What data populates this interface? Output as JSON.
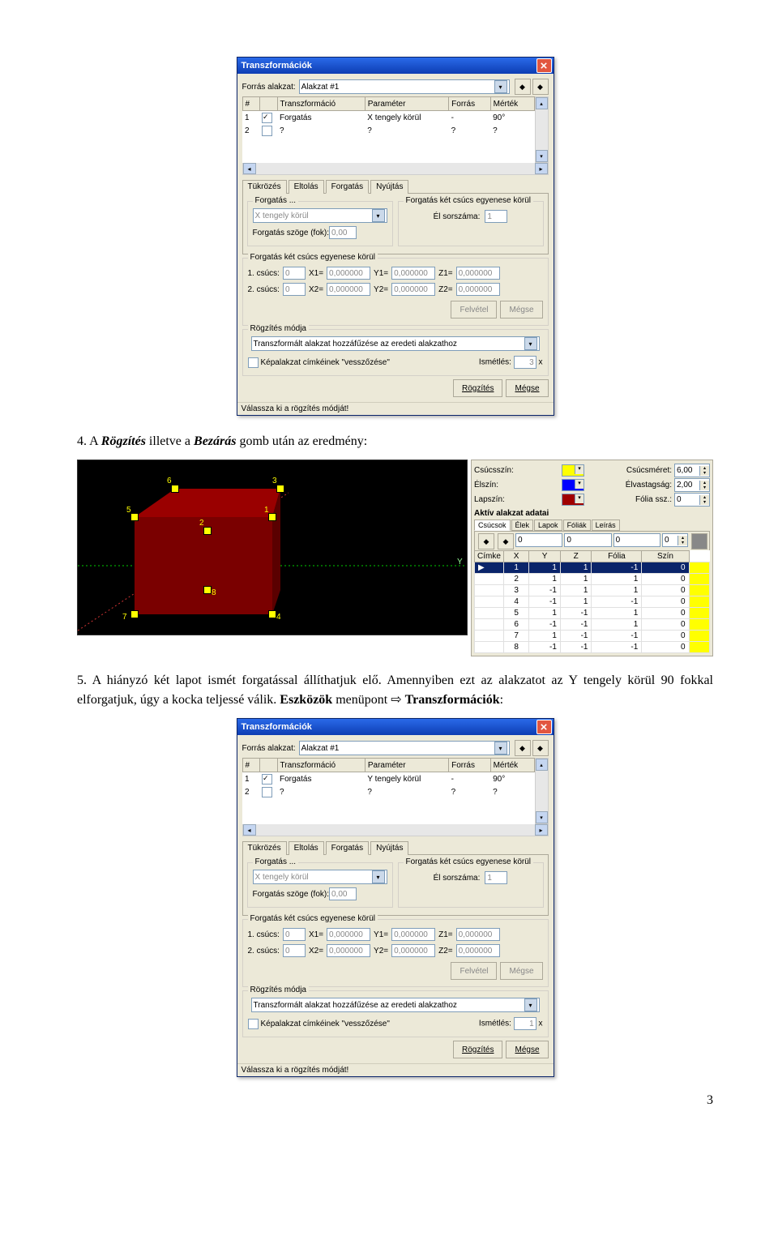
{
  "dialog1": {
    "title": "Transzformációk",
    "source_label": "Forrás alakzat:",
    "source_value": "Alakzat #1",
    "grid_headers": [
      "#",
      "",
      "Transzformáció",
      "Paraméter",
      "Forrás",
      "Mérték"
    ],
    "grid_rows": [
      {
        "n": "1",
        "chk": true,
        "transz": "Forgatás",
        "param": "X tengely körül",
        "forras": "-",
        "mertek": "90°"
      },
      {
        "n": "2",
        "chk": false,
        "transz": "?",
        "param": "?",
        "forras": "?",
        "mertek": "?"
      }
    ],
    "tabs": [
      "Tükrözés",
      "Eltolás",
      "Forgatás",
      "Nyújtás"
    ],
    "active_tab": 2,
    "forgatas_legend": "Forgatás ...",
    "forgatas_axis": "X tengely körül",
    "forgatas_szog_label": "Forgatás szöge (fok):",
    "forgatas_szog_val": "0,00",
    "forgatas_2csucs_legend": "Forgatás két csúcs egyenese körül",
    "el_sorszama": "Él sorszáma:",
    "el_sorszama_val": "1",
    "csucs1": "1. csúcs:",
    "csucs2": "2. csúcs:",
    "zero": "0",
    "coord_zero": "0,000000",
    "X1": "X1=",
    "Y1": "Y1=",
    "Z1": "Z1=",
    "X2": "X2=",
    "Y2": "Y2=",
    "Z2": "Z2=",
    "felvetel": "Felvétel",
    "megse": "Mégse",
    "rogzites_legend": "Rögzítés módja",
    "rogzites_val": "Transzformált alakzat hozzáfűzése az eredeti alakzathoz",
    "kepalakzat": "Képalakzat címkéinek \"vesszőzése\"",
    "ismetles": "Ismétlés:",
    "ismetles_val": "3",
    "x": "x",
    "rogzites_btn": "Rögzítés",
    "megse_btn": "Mégse",
    "status": "Válassza ki a rögzítés módját!"
  },
  "dialog2": {
    "title": "Transzformációk",
    "grid_rows": [
      {
        "n": "1",
        "chk": true,
        "transz": "Forgatás",
        "param": "Y tengely körül",
        "forras": "-",
        "mertek": "90°"
      },
      {
        "n": "2",
        "chk": false,
        "transz": "?",
        "param": "?",
        "forras": "?",
        "mertek": "?"
      }
    ],
    "ismetles_val": "1"
  },
  "para1": {
    "num": "4.",
    "text_a": "A ",
    "rogzites": "Rögzítés",
    "text_b": " illetve a ",
    "bezaras": "Bezárás",
    "text_c": " gomb után az eredmény:"
  },
  "para2": {
    "num": "5.",
    "text_a": "A hiányzó két lapot ismét forgatással állíthatjuk elő. Amennyiben ezt az alakzatot az Y tengely körül 90 fokkal elforgatjuk, úgy a kocka teljessé válik. ",
    "eszkozok": "Eszközök",
    "text_b": " menüpont ",
    "arrow": "⇨ ",
    "transz": "Transzformációk",
    "colon": ":"
  },
  "props": {
    "csucsszin": "Csúcsszín:",
    "csucsmeret": "Csúcsméret:",
    "csucsmeret_val": "6,00",
    "elszin": "Élszín:",
    "elvastagsag": "Élvastagság:",
    "elvastagsag_val": "2,00",
    "lapszin": "Lapszín:",
    "folia_ssz": "Fólia ssz.:",
    "folia_ssz_val": "0",
    "aktiv_title": "Aktív alakzat adatai",
    "mini_tabs": [
      "Csúcsok",
      "Élek",
      "Lapok",
      "Fóliák",
      "Leírás"
    ],
    "spinner_row": [
      "0",
      "0",
      "0",
      "0"
    ],
    "headers": [
      "Címke",
      "X",
      "Y",
      "Z",
      "Fólia",
      "Szín"
    ],
    "rows": [
      {
        "c": "1",
        "x": "1",
        "y": "1",
        "z": "-1",
        "f": "0"
      },
      {
        "c": "2",
        "x": "1",
        "y": "1",
        "z": "1",
        "f": "0"
      },
      {
        "c": "3",
        "x": "-1",
        "y": "1",
        "z": "1",
        "f": "0"
      },
      {
        "c": "4",
        "x": "-1",
        "y": "1",
        "z": "-1",
        "f": "0"
      },
      {
        "c": "5",
        "x": "1",
        "y": "-1",
        "z": "1",
        "f": "0"
      },
      {
        "c": "6",
        "x": "-1",
        "y": "-1",
        "z": "1",
        "f": "0"
      },
      {
        "c": "7",
        "x": "1",
        "y": "-1",
        "z": "-1",
        "f": "0"
      },
      {
        "c": "8",
        "x": "-1",
        "y": "-1",
        "z": "-1",
        "f": "0"
      }
    ],
    "colors": {
      "csucs": "#ffff00",
      "el": "#0000ff",
      "lap": "#a00000"
    }
  },
  "viewport": {
    "axis_y": "Y",
    "points": [
      "1",
      "2",
      "3",
      "4",
      "5",
      "6",
      "7",
      "8"
    ]
  },
  "page_number": "3"
}
